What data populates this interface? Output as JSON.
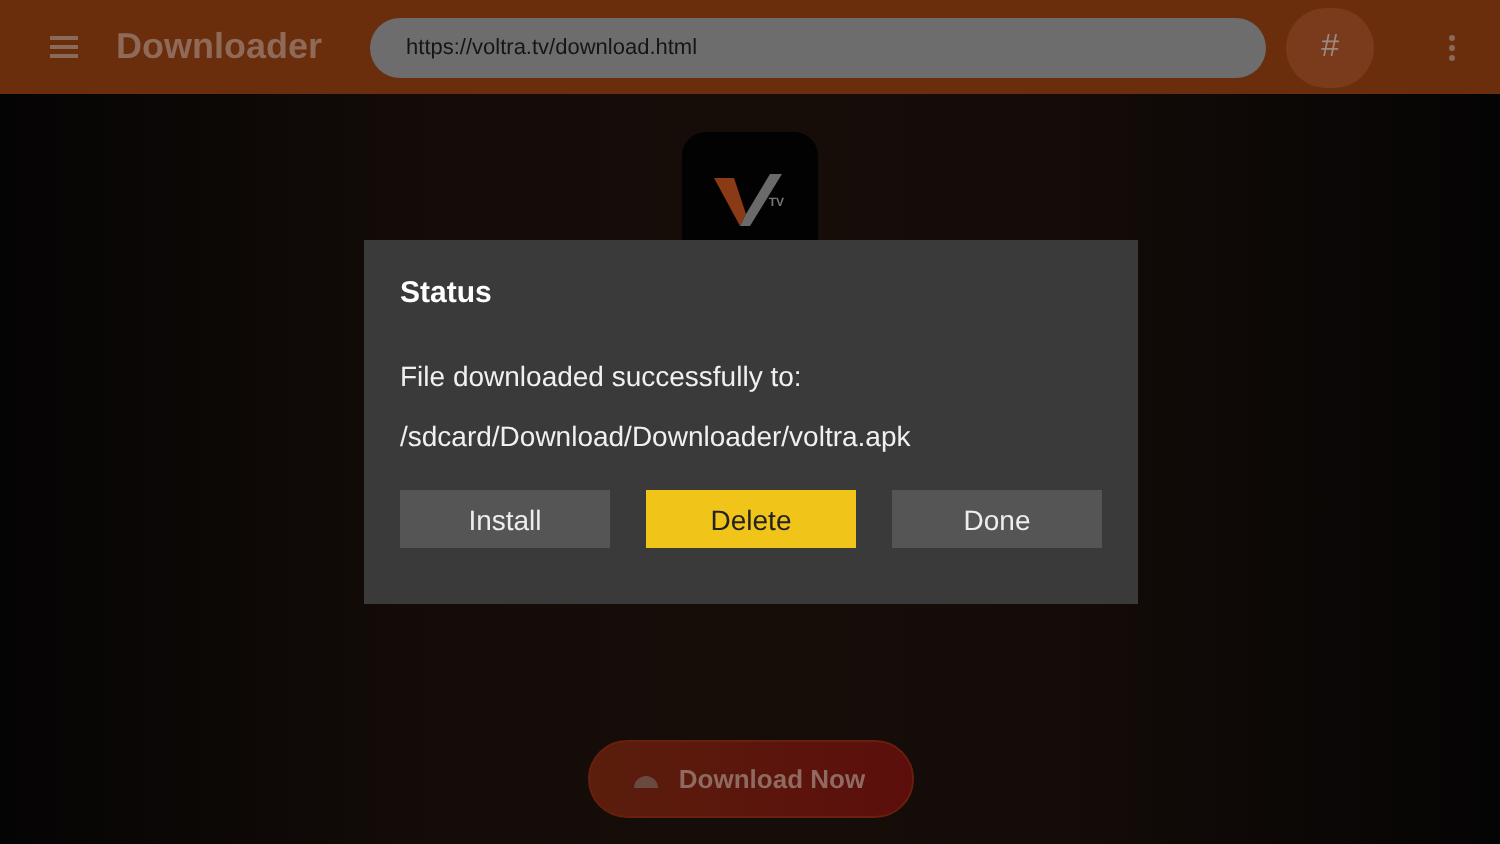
{
  "app_bar": {
    "title": "Downloader",
    "url": "https://voltra.tv/download.html",
    "hash_button": "#"
  },
  "app_icon": {
    "badge": "TV"
  },
  "dialog": {
    "title": "Status",
    "message": "File downloaded successfully to:",
    "path": "/sdcard/Download/Downloader/voltra.apk",
    "buttons": [
      {
        "label": "Install",
        "selected": false
      },
      {
        "label": "Delete",
        "selected": true
      },
      {
        "label": "Done",
        "selected": false
      }
    ]
  },
  "download_button": {
    "label": "Download Now"
  }
}
